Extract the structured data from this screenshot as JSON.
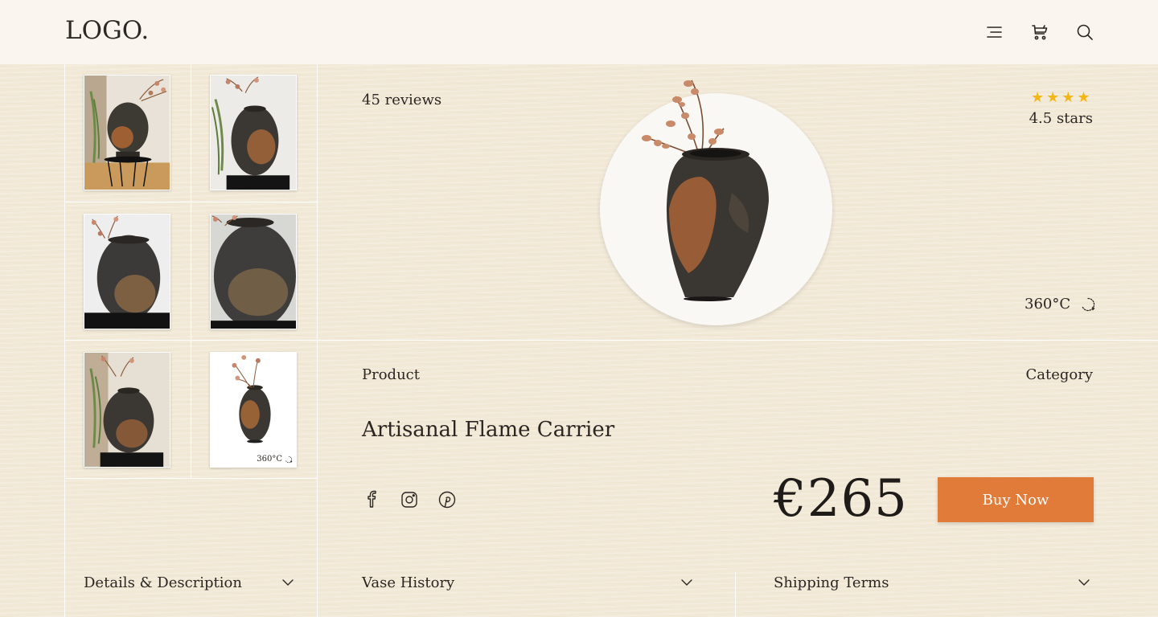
{
  "header": {
    "logo": "LOGO."
  },
  "icons": {
    "menu": "menu-icon",
    "cart": "cart-icon",
    "search": "search-icon"
  },
  "thumbnails": [
    {
      "label": "thumbnail-1"
    },
    {
      "label": "thumbnail-2"
    },
    {
      "label": "thumbnail-3"
    },
    {
      "label": "thumbnail-4"
    },
    {
      "label": "thumbnail-5"
    },
    {
      "label": "thumbnail-6",
      "caption": "360°C"
    }
  ],
  "product": {
    "reviews": "45 reviews",
    "rating": 4.5,
    "stars_shown": 4,
    "rating_text": "4.5 stars",
    "rotate_label": "360°C",
    "product_label": "Product",
    "category_label": "Category",
    "name": "Artisanal Flame Carrier",
    "price": "€265",
    "buy_label": "Buy Now"
  },
  "social": [
    "facebook-icon",
    "instagram-icon",
    "pinterest-icon"
  ],
  "accordions": {
    "details": "Details & Description",
    "history": "Vase History",
    "shipping": "Shipping Terms"
  },
  "colors": {
    "accent": "#e07b3a",
    "star": "#f2b617",
    "background": "#f1e8d6"
  }
}
